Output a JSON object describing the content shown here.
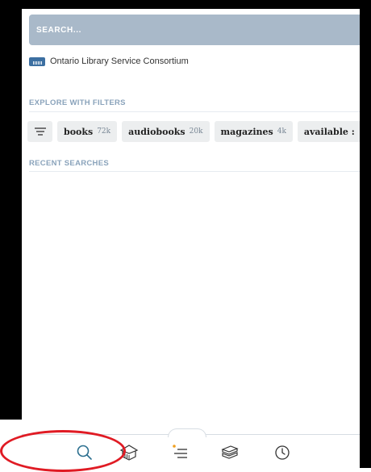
{
  "search": {
    "placeholder": "SEARCH..."
  },
  "library": {
    "name": "Ontario Library Service Consortium",
    "logo_icon": "library-logo-icon"
  },
  "explore": {
    "heading": "EXPLORE WITH FILTERS",
    "filters_icon": "filter-lines-icon",
    "chips": [
      {
        "name": "books",
        "count": "72k"
      },
      {
        "name": "audiobooks",
        "count": "20k"
      },
      {
        "name": "magazines",
        "count": "4k"
      },
      {
        "name": "available :",
        "count": ""
      }
    ]
  },
  "recent": {
    "heading": "RECENT SEARCHES"
  },
  "bottom_nav": {
    "items": [
      {
        "name": "search",
        "icon": "search-icon"
      },
      {
        "name": "library",
        "icon": "library-building-icon"
      },
      {
        "name": "menu",
        "icon": "menu-lines-icon"
      },
      {
        "name": "shelf",
        "icon": "books-stack-icon"
      },
      {
        "name": "activity",
        "icon": "clock-icon"
      }
    ]
  },
  "colors": {
    "search_bar": "#a9b9c9",
    "section_label": "#8aa3bb",
    "chip_bg": "#eceeef",
    "highlight_circle": "#e01b24",
    "notification_dot": "#f0a020"
  }
}
